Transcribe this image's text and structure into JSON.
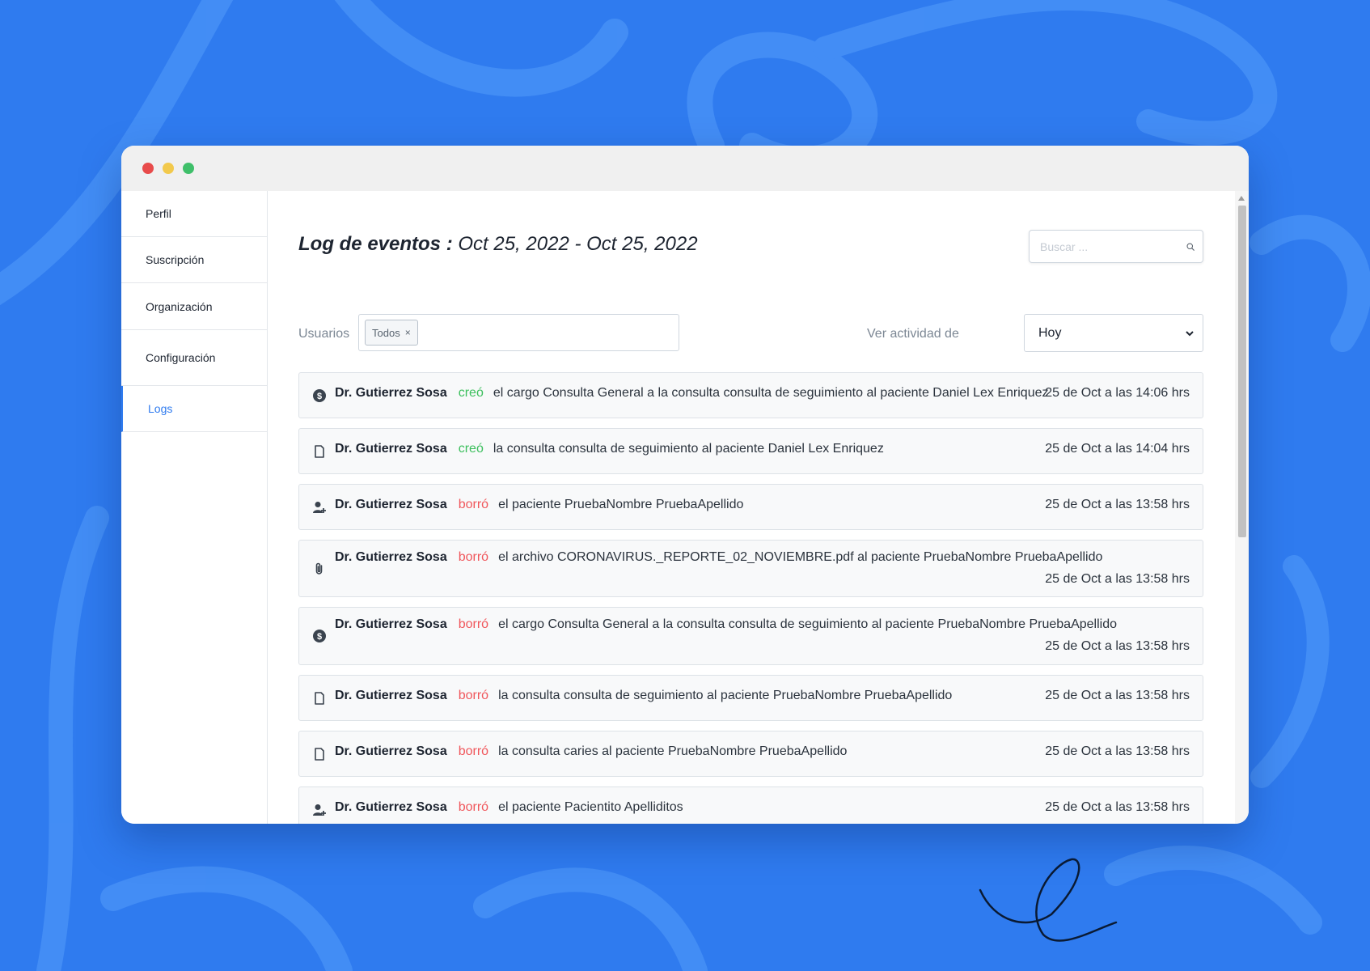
{
  "colors": {
    "background": "#2f7bef",
    "accent": "#2f7bef",
    "created": "#3bbf5c",
    "deleted": "#f0565b"
  },
  "window_controls": [
    "close",
    "minimize",
    "maximize"
  ],
  "sidebar": {
    "items": [
      {
        "label": "Perfil"
      },
      {
        "label": "Suscripción"
      },
      {
        "label": "Organización"
      },
      {
        "label": "Configuración"
      },
      {
        "label": "Logs",
        "active": true
      }
    ]
  },
  "header": {
    "title": "Log de eventos",
    "separator": " : ",
    "range": "Oct 25, 2022 - Oct 25, 2022"
  },
  "search": {
    "placeholder": "Buscar ...",
    "icon": "search-icon"
  },
  "filters": {
    "users_label": "Usuarios",
    "users_tag": "Todos",
    "users_tag_remove": "×",
    "activity_label": "Ver actividad de",
    "activity_value": "Hoy"
  },
  "logs": [
    {
      "icon": "dollar-icon",
      "actor": "Dr. Gutierrez Sosa",
      "verb": "creó",
      "verb_type": "created",
      "text": "el cargo Consulta General a la consulta consulta de seguimiento al paciente Daniel Lex Enriquez",
      "time": "25 de Oct a las 14:06 hrs"
    },
    {
      "icon": "document-icon",
      "actor": "Dr. Gutierrez Sosa",
      "verb": "creó",
      "verb_type": "created",
      "text": "la consulta consulta de seguimiento al paciente Daniel Lex Enriquez",
      "time": "25 de Oct a las 14:04 hrs"
    },
    {
      "icon": "user-add-icon",
      "actor": "Dr. Gutierrez Sosa",
      "verb": "borró",
      "verb_type": "deleted",
      "text": "el paciente PruebaNombre PruebaApellido",
      "time": "25 de Oct a las 13:58 hrs"
    },
    {
      "icon": "paperclip-icon",
      "actor": "Dr. Gutierrez Sosa",
      "verb": "borró",
      "verb_type": "deleted",
      "text": "el archivo CORONAVIRUS._REPORTE_02_NOVIEMBRE.pdf al paciente PruebaNombre PruebaApellido",
      "time": "25 de Oct a las 13:58 hrs"
    },
    {
      "icon": "dollar-icon",
      "actor": "Dr. Gutierrez Sosa",
      "verb": "borró",
      "verb_type": "deleted",
      "text": "el cargo Consulta General a la consulta consulta de seguimiento al paciente PruebaNombre PruebaApellido",
      "time": "25 de Oct a las 13:58 hrs"
    },
    {
      "icon": "document-icon",
      "actor": "Dr. Gutierrez Sosa",
      "verb": "borró",
      "verb_type": "deleted",
      "text": "la consulta consulta de seguimiento al paciente PruebaNombre PruebaApellido",
      "time": "25 de Oct a las 13:58 hrs"
    },
    {
      "icon": "document-icon",
      "actor": "Dr. Gutierrez Sosa",
      "verb": "borró",
      "verb_type": "deleted",
      "text": "la consulta caries al paciente PruebaNombre PruebaApellido",
      "time": "25 de Oct a las 13:58 hrs"
    },
    {
      "icon": "user-add-icon",
      "actor": "Dr. Gutierrez Sosa",
      "verb": "borró",
      "verb_type": "deleted",
      "text": "el paciente Pacientito Apelliditos",
      "time": "25 de Oct a las 13:58 hrs"
    }
  ]
}
